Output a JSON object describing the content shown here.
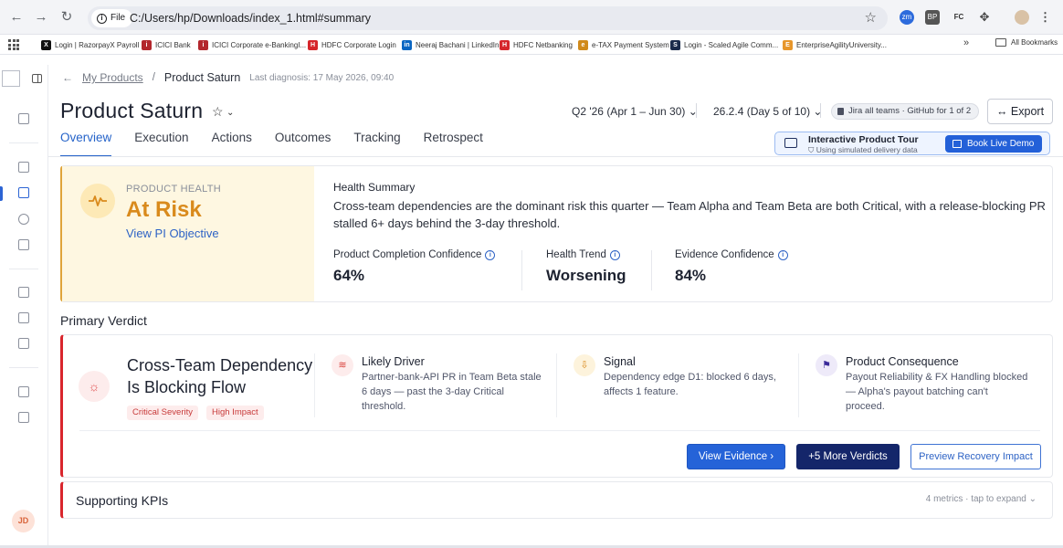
{
  "browser": {
    "file_label": "File",
    "url": "C:/Users/hp/Downloads/index_1.html#summary",
    "extensions": [
      "zm",
      "BP",
      "FC"
    ],
    "bookmarks": [
      {
        "label": "Login | RazorpayX Payroll",
        "color": "#111111",
        "glyph": "X"
      },
      {
        "label": "ICICI Bank",
        "color": "#b3272d",
        "glyph": "i"
      },
      {
        "label": "ICICI Corporate e-BankingI...",
        "color": "#b3272d",
        "glyph": "i"
      },
      {
        "label": "HDFC Corporate  Login",
        "color": "#d6262b",
        "glyph": "H"
      },
      {
        "label": "Neeraj Bachani | LinkedIn",
        "color": "#0a66c2",
        "glyph": "in"
      },
      {
        "label": "HDFC Netbanking",
        "color": "#d6262b",
        "glyph": "H"
      },
      {
        "label": "e-TAX Payment System",
        "color": "#d08a1b",
        "glyph": "e"
      },
      {
        "label": "Login - Scaled Agile Comm...",
        "color": "#1b2b4b",
        "glyph": "S"
      },
      {
        "label": "EnterpriseAgilityUniversity...",
        "color": "#e7962b",
        "glyph": "E"
      }
    ],
    "all_bookmarks": "All Bookmarks"
  },
  "user": {
    "initials": "JD"
  },
  "breadcrumb": {
    "parent": "My Products",
    "separator": "/",
    "current": "Product Saturn",
    "last_diagnosis": "Last diagnosis: 17 May 2026, 09:40"
  },
  "header": {
    "title": "Product Saturn",
    "quarter": "Q2 '26 (Apr 1 – Jun 30)",
    "release": "26.2.4 (Day 5 of 10)",
    "sources": "Jira all teams · GitHub for 1 of 2",
    "export": "Export"
  },
  "tabs": [
    "Overview",
    "Execution",
    "Actions",
    "Outcomes",
    "Tracking",
    "Retrospect"
  ],
  "tour": {
    "title": "Interactive Product Tour",
    "subtitle": "Using simulated delivery data",
    "button": "Book Live Demo"
  },
  "health": {
    "label": "PRODUCT HEALTH",
    "status": "At Risk",
    "link": "View PI Objective",
    "summary_title": "Health Summary",
    "summary_text": "Cross-team dependencies are the dominant risk this quarter — Team Alpha and Team Beta are both Critical, with a release-blocking PR stalled 6+ days behind the 3-day threshold.",
    "metrics": [
      {
        "label": "Product Completion Confidence",
        "value": "64%"
      },
      {
        "label": "Health Trend",
        "value": "Worsening"
      },
      {
        "label": "Evidence Confidence",
        "value": "84%"
      }
    ],
    "accent_color": "#d98a1c"
  },
  "verdict": {
    "section_title": "Primary Verdict",
    "title": "Cross-Team Dependency Is Blocking Flow",
    "tags": [
      "Critical Severity",
      "High Impact"
    ],
    "columns": [
      {
        "title": "Likely Driver",
        "text": "Partner-bank-API PR in Team Beta stale 6 days — past the 3-day Critical threshold.",
        "icon": "driver-icon",
        "glyph": "≋",
        "bg": "#fdecec",
        "fg": "#d9403a"
      },
      {
        "title": "Signal",
        "text": "Dependency edge D1: blocked 6 days, affects 1 feature.",
        "icon": "signal-icon",
        "glyph": "⇩",
        "bg": "#fdf3dc",
        "fg": "#d98a1c"
      },
      {
        "title": "Product Consequence",
        "text": "Payout Reliability & FX Handling blocked — Alpha's payout batching can't proceed.",
        "icon": "flag-icon",
        "glyph": "⚑",
        "bg": "#eeeaf9",
        "fg": "#3b2b9a"
      }
    ],
    "buttons": {
      "evidence": "View Evidence ›",
      "more": "+5 More Verdicts",
      "recovery": "Preview Recovery Impact"
    },
    "accent_color": "#d9262d"
  },
  "kpis": {
    "title": "Supporting KPIs",
    "meta": "4 metrics · tap to expand"
  }
}
